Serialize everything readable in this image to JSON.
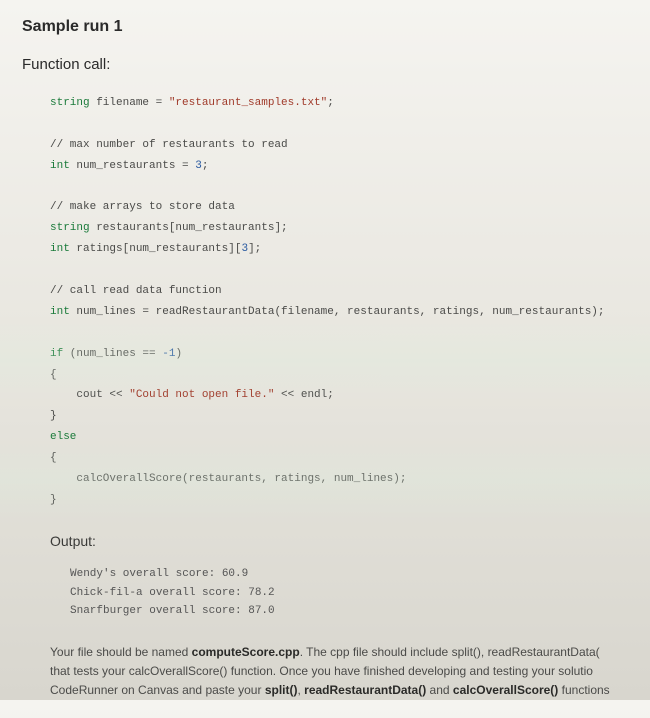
{
  "title": "Sample run 1",
  "section_func": "Function call:",
  "code": {
    "l1a": "string",
    "l1b": " filename = ",
    "l1c": "\"restaurant_samples.txt\"",
    "l1d": ";",
    "l2": "// max number of restaurants to read",
    "l3a": "int",
    "l3b": " num_restaurants = ",
    "l3c": "3",
    "l3d": ";",
    "l4": "// make arrays to store data",
    "l5a": "string",
    "l5b": " restaurants[num_restaurants];",
    "l6a": "int",
    "l6b": " ratings[num_restaurants][",
    "l6c": "3",
    "l6d": "];",
    "l7": "// call read data function",
    "l8a": "int",
    "l8b": " num_lines = readRestaurantData(filename, restaurants, ratings, num_restaurants);",
    "l9a": "if",
    "l9b": " (num_lines == ",
    "l9c": "-1",
    "l9d": ")",
    "l10": "{",
    "l11a": "    cout << ",
    "l11b": "\"Could not open file.\"",
    "l11c": " << endl;",
    "l12": "}",
    "l13": "else",
    "l14": "{",
    "l15": "    calcOverallScore(restaurants, ratings, num_lines);",
    "l16": "}"
  },
  "output_heading": "Output:",
  "output": [
    "Wendy's overall score: 60.9",
    "Chick-fil-a overall score: 78.2",
    "Snarfburger overall score: 87.0"
  ],
  "instructions": {
    "pre1": "Your file should be named ",
    "b1": "computeScore.cpp",
    "post1": ". The cpp file should include split(), readRestaurantData(",
    "line2": "that tests your calcOverallScore() function. Once you have finished developing and testing your solutio",
    "line3a": "CodeRunner on Canvas and paste your ",
    "b3a": "split()",
    "line3b": ", ",
    "b3b": "readRestaurantData()",
    "line3c": " and ",
    "b3c": "calcOverallScore()",
    "line3d": " functions"
  }
}
